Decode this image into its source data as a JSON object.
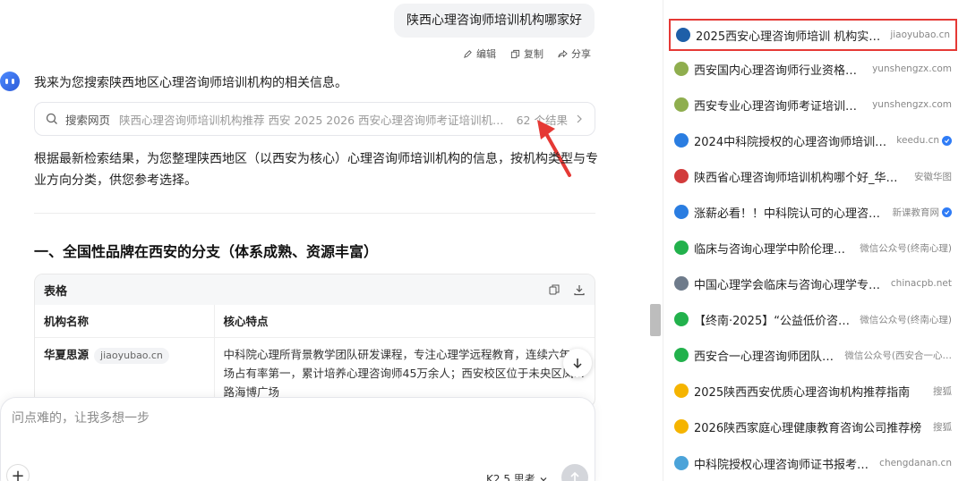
{
  "chat": {
    "user_message": "陕西心理咨询师培训机构哪家好",
    "actions": {
      "edit": "编辑",
      "copy": "复制",
      "share": "分享"
    },
    "intro": "我来为您搜索陕西地区心理咨询师培训机构的相关信息。",
    "search": {
      "label": "搜索网页",
      "query": "陕西心理咨询师培训机构推荐 西安 2025 2026 西安心理咨询师考证培训机构排…",
      "count": "62 个结果"
    },
    "paragraph": "根据最新检索结果，为您整理陕西地区（以西安为核心）心理咨询师培训机构的信息，按机构类型与专业方向分类，供您参考选择。",
    "section_heading": "一、全国性品牌在西安的分支（体系成熟、资源丰富）",
    "table": {
      "title": "表格",
      "columns": [
        "机构名称",
        "核心特点"
      ],
      "rows": [
        {
          "name": "华夏思源",
          "site": "jiaoyubao.cn",
          "desc": "中科院心理所背景教学团队研发课程，专注心理学远程教育，连续六年…场占有率第一，累计培养心理咨询师45万余人；西安校区位于未央区凤…路海博广场"
        }
      ]
    },
    "composer": {
      "placeholder": "问点难的，让我多想一步",
      "model": "K2.5 思考"
    }
  },
  "sources": [
    {
      "title": "2025西安心理咨询师培训 机构实力…",
      "site": "jiaoyubao.cn",
      "verified": false,
      "icon": "jiaoyubao-icon",
      "color": "#1e5fa8"
    },
    {
      "title": "西安国内心理咨询师行业资格证…",
      "site": "yunshengzx.com",
      "verified": false,
      "icon": "yunsheng-icon",
      "color": "#8fae4e"
    },
    {
      "title": "西安专业心理咨询师考证培训机…",
      "site": "yunshengzx.com",
      "verified": false,
      "icon": "yunsheng-icon",
      "color": "#8fae4e"
    },
    {
      "title": "2024中科院授权的心理咨询师培训…",
      "site": "keedu.cn",
      "verified": true,
      "icon": "keedu-icon",
      "color": "#2a7de1"
    },
    {
      "title": "陕西省心理咨询师培训机构哪个好_华…",
      "site": "安徽华图",
      "verified": false,
      "icon": "huatu-icon",
      "color": "#d23b3b"
    },
    {
      "title": "涨薪必看！！中科院认可的心理咨…",
      "site": "新课教育网",
      "verified": true,
      "icon": "xinke-icon",
      "color": "#2a7de1"
    },
    {
      "title": "临床与咨询心理学中阶伦理…",
      "site": "微信公众号(终南心理)",
      "verified": false,
      "icon": "wechat-icon",
      "color": "#22b14c"
    },
    {
      "title": "中国心理学会临床与咨询心理学专…",
      "site": "chinacpb.net",
      "verified": false,
      "icon": "chinacpb-icon",
      "color": "#6e7b8b"
    },
    {
      "title": "【终南·2025】“公益低价咨询…",
      "site": "微信公众号(终南心理)",
      "verified": false,
      "icon": "wechat-icon",
      "color": "#22b14c"
    },
    {
      "title": "西安合一心理咨询师团队…",
      "site": "微信公众号(西安合一心…",
      "verified": false,
      "icon": "wechat-icon",
      "color": "#22b14c"
    },
    {
      "title": "2025陕西西安优质心理咨询机构推荐指南",
      "site": "搜狐",
      "verified": false,
      "icon": "sohu-icon",
      "color": "#f5b400"
    },
    {
      "title": "2026陕西家庭心理健康教育咨询公司推荐榜",
      "site": "搜狐",
      "verified": false,
      "icon": "sohu-icon",
      "color": "#f5b400"
    },
    {
      "title": "中科院授权心理咨询师证书报考机…",
      "site": "chengdanan.cn",
      "verified": false,
      "icon": "chengdanan-icon",
      "color": "#4ba3d9"
    }
  ]
}
